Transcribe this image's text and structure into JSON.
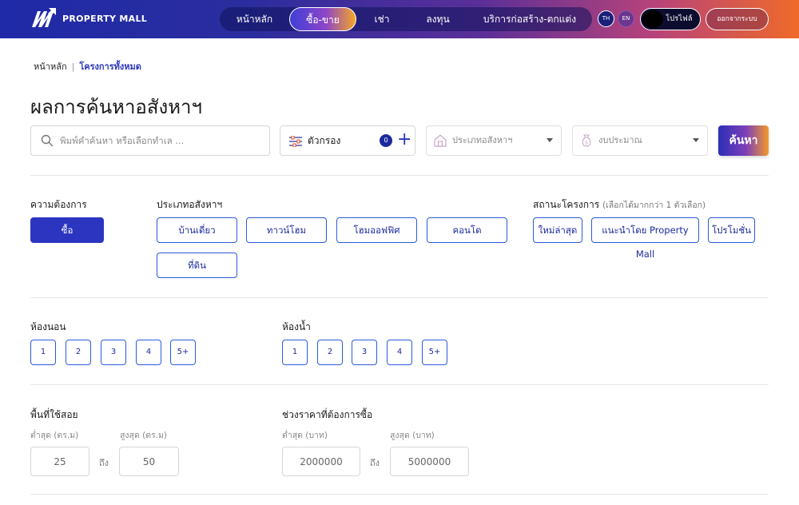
{
  "header": {
    "brand": "PROPERTY MALL",
    "nav": [
      "หน้าหลัก",
      "ซื้อ-ขาย",
      "เช่า",
      "ลงทุน",
      "บริการก่อสร้าง-ตกแต่ง"
    ],
    "active_nav": "ซื้อ-ขาย",
    "lang_th": "TH",
    "lang_en": "EN",
    "profile_label": "โปรไฟล์",
    "logout_label": "ออกจากระบบ"
  },
  "breadcrumb": {
    "home": "หน้าหลัก",
    "separator": "|",
    "current": "โครงการทั้งหมด"
  },
  "page_title": "ผลการค้นหาอสังหาฯ",
  "search": {
    "placeholder": "พิมพ์คำค้นหา หรือเลือกทำเล ...",
    "filter_label": "ตัวกรอง",
    "filter_count": "0",
    "property_type_placeholder": "ประเภทอสังหาฯ",
    "budget_placeholder": "งบประมาณ",
    "button_label": "ค้นหา"
  },
  "need": {
    "label": "ความต้องการ",
    "selected": "ซื้อ"
  },
  "property_types": {
    "label": "ประเภทอสังหาฯ",
    "options": [
      "บ้านเดี่ยว",
      "ทาวน์โฮม",
      "โฮมออฟฟิศ",
      "คอนโด",
      "ที่ดิน"
    ]
  },
  "project_status": {
    "label": "สถานะโครงการ",
    "hint": "(เลือกได้มากกว่า 1 ตัวเลือก)",
    "options": [
      "ใหม่ล่าสุด",
      "แนะนำโดย Property Mall",
      "โปรโมชั่น"
    ]
  },
  "bedrooms": {
    "label": "ห้องนอน",
    "options": [
      "1",
      "2",
      "3",
      "4",
      "5+"
    ]
  },
  "bathrooms": {
    "label": "ห้องน้ำ",
    "options": [
      "1",
      "2",
      "3",
      "4",
      "5+"
    ]
  },
  "area": {
    "label": "พื้นที่ใช้สอย",
    "min_label": "ต่ำสุด (ตร.ม)",
    "max_label": "สูงสุด (ตร.ม)",
    "min_value": "25",
    "max_value": "50",
    "to": "ถึง"
  },
  "price": {
    "label": "ช่วงราคาที่ต้องการซื้อ",
    "min_label": "ต่ำสุด (บาท)",
    "max_label": "สูงสุด (บาท)",
    "min_value": "2000000",
    "max_value": "5000000",
    "to": "ถึง"
  },
  "colors": {
    "primary": "#2b35c0",
    "chip_border": "#2a5bd8",
    "accent_orange": "#f39a2a"
  },
  "icons": {
    "logo": "brand-logo-icon",
    "search": "search-icon",
    "filter": "sliders-icon",
    "property_type": "house-icon",
    "budget": "money-bag-icon",
    "add": "plus-icon",
    "dropdown": "chevron-down-icon"
  }
}
